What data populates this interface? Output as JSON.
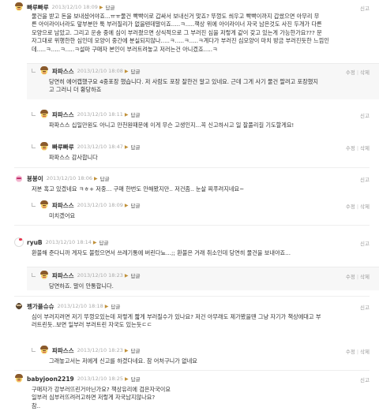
{
  "labels": {
    "reply": "답글",
    "report": "신고",
    "edit": "수정",
    "delete": "삭제"
  },
  "comments": [
    {
      "nick": "빠루빠루",
      "date": "2013/12/10 18:09",
      "body": "물건을 받고 돈을 보내셨어야죠...ㅠㅠ물건 빡빡이로 갑싸서 보내신거 맞죠? 뚜껑도 씌우고 빡빡이까지 갑쌌으면 아무리 무\n른 아이라이너라도 앞부분만 툭 부러질리가 없을텐데말이죠.....ㅋ.....책상 위에 아이라이너 자국 남은것도 사진 두개가 다른\n모양으로 남았고. 그리고 운송 중에 심이 부러졌으면 상식적으로 그 부러진 심을 저렇게 같이 갖고 있는게 가능한가요??? 문\n자그대로 위행한한 심인데 모양이 중간에 분실되지않나.....ㅋ.....ㅋ.....ㅋ계다가 부러진 심모양이 마치 방금 부러진듯한 느낌인\n데.....ㅋ.....ㅋ.....ㅋ설마 구매자 본인이 부러트려놓고 저러는건 아니겠죠.....ㅋ"
    },
    {
      "nick": "파파스스",
      "date": "2013/12/10 18:08",
      "body": "당연히 에어캡했구요 4중포장 했습니다. 저 사람도 포장 잘한건 알고 있네요. 근데 그게 사기 물건 팔려고 포장했지\n고 그러니 더 황당하죠"
    },
    {
      "nick": "파파스스",
      "date": "2013/12/10 18:11",
      "body": "파파스스 십일만원도 아니고 만천원때문에 이게 무슨 고생인지...꼭 신고하시고 일 잘풀리길 기도할게요!"
    },
    {
      "nick": "빠루빠루",
      "date": "2013/12/10 18:47",
      "body": "파파스스 감사합니다"
    },
    {
      "nick": "뵹뵹이",
      "date": "2013/12/10 18:06",
      "body": "저분 혹고 있겠네요 ㅋㅎ+ 저중... 구매 한번도 안해봤지만.. 저건좀.. 눈살 찌푸려지네요~"
    },
    {
      "nick": "파파스스",
      "date": "2013/12/10 18:09",
      "body": "미치겠어요"
    },
    {
      "nick": "ryuB",
      "date": "2013/12/10 18:14",
      "body": "환불해 준다니까 게자도 불렀으면서 쓰레기통에 버린다뇨...;; 환불은 거래 취소인데 당연히 물건을 보내야죠..."
    },
    {
      "nick": "파파스스",
      "date": "2013/12/10 18:23",
      "body": "당연하죠. 말이 안통합니다."
    },
    {
      "nick": "펭가플슈슈",
      "date": "2013/12/10 18:18",
      "body": "심이 부러지려면 저기 뚜껑오있는데 저렇게 짧게 부러질수가 있나요? 저건 아무래도 제가봤을땐 그냥 자기가 책상에대고 부\n러트린듯..보면 일부러 부러트린 자국도 있는듯ㄷㄷ"
    },
    {
      "nick": "파파스스",
      "date": "2013/12/10 18:23",
      "body": "그래놓고서는 저에게 신고를 하겠다네요. 참 어처구니가 없네요"
    },
    {
      "nick": "babyjoon2219",
      "date": "2013/12/10 18:25",
      "body": "구매자가 강부러뜨린거아닌가요? 책상유리에 검은자국이요\n일부러 심부러뜨려러고하면 저렇게 자국남지않나요?\n참.."
    }
  ]
}
